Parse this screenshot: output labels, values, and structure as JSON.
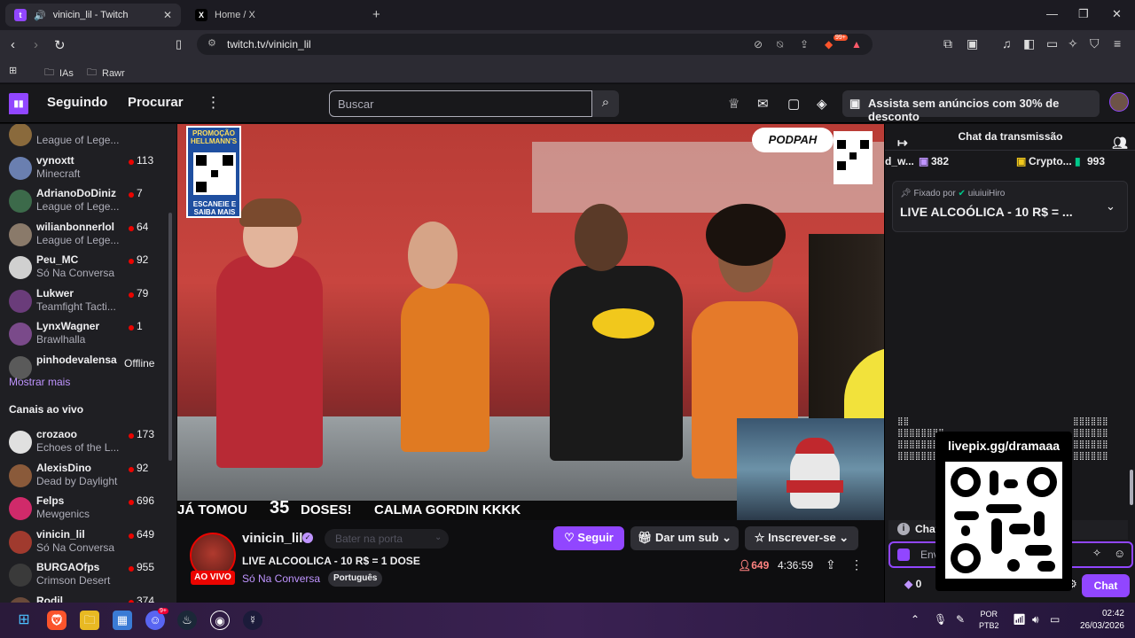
{
  "browser": {
    "tabs": [
      {
        "title": "vinicin_lil - Twitch"
      },
      {
        "title": "Home / X"
      }
    ],
    "url": "twitch.tv/vinicin_lil",
    "bookmarks": [
      "IAs",
      "Rawr"
    ],
    "brave_badge": "99+"
  },
  "twitch_nav": {
    "following": "Seguindo",
    "browse": "Procurar",
    "search_placeholder": "Buscar",
    "promo": "Assista sem anúncios com 30% de desconto"
  },
  "sidebar": {
    "followed": [
      {
        "name": "",
        "game": "League of Lege...",
        "viewers": "",
        "color": "#8a6a3c"
      },
      {
        "name": "vynoxtt",
        "game": "Minecraft",
        "viewers": "113",
        "color": "#6a7fb0"
      },
      {
        "name": "AdrianoDoDiniz",
        "game": "League of Lege...",
        "viewers": "7",
        "color": "#3c6a4a"
      },
      {
        "name": "wilianbonnerlol",
        "game": "League of Lege...",
        "viewers": "64",
        "color": "#8a7a6a"
      },
      {
        "name": "Peu_MC",
        "game": "Só Na Conversa",
        "viewers": "92",
        "color": "#d0d0d0"
      },
      {
        "name": "Lukwer",
        "game": "Teamfight Tacti...",
        "viewers": "79",
        "color": "#6a3c7a"
      },
      {
        "name": "LynxWagner",
        "game": "Brawlhalla",
        "viewers": "1",
        "color": "#7a4a8a"
      },
      {
        "name": "pinhodevalensa",
        "game": "",
        "viewers": "",
        "offline": "Offline",
        "color": "#5a5a5a"
      }
    ],
    "show_more": "Mostrar mais",
    "live_header": "Canais ao vivo",
    "live": [
      {
        "name": "crozaoo",
        "game": "Echoes of the L...",
        "viewers": "173",
        "color": "#e0e0e0"
      },
      {
        "name": "AlexisDino",
        "game": "Dead by Daylight",
        "viewers": "92",
        "color": "#8a5a3a"
      },
      {
        "name": "Felps",
        "game": "Mewgenics",
        "viewers": "696",
        "color": "#d02a6a"
      },
      {
        "name": "vinicin_lil",
        "game": "Só Na Conversa",
        "viewers": "649",
        "color": "#a03a2e"
      },
      {
        "name": "BURGAOfps",
        "game": "Crimson Desert",
        "viewers": "955",
        "color": "#3a3a3a"
      },
      {
        "name": "Rodil",
        "game": "",
        "viewers": "374",
        "color": "#6a4a3a"
      }
    ]
  },
  "video": {
    "hellmanns": "PROMOÇÃO HELLMANN'S",
    "hellmanns_cta": "ESCANEIE E SAIBA MAIS",
    "podpah": "PODPAH",
    "ticker": [
      "JÁ TOMOU",
      "35",
      "DOSES!",
      "CALMA GORDIN KKKK"
    ]
  },
  "stream": {
    "streamer": "vinicin_lil",
    "knock": "Bater na porta",
    "title": "LIVE ALCOOLICA - 10 R$ = 1 DOSE",
    "category": "Só Na Conversa",
    "tag": "Português",
    "live_badge": "AO VIVO",
    "follow": "Seguir",
    "gift": "Dar um sub",
    "subscribe": "Inscrever-se",
    "viewers": "649",
    "uptime": "4:36:59"
  },
  "chat": {
    "header": "Chat da transmissão",
    "gifts": [
      {
        "name": "d_w...",
        "count": "382"
      },
      {
        "name": "Crypto...",
        "count": "993"
      }
    ],
    "pinned_by_label": "Fixado por",
    "pinned_by_user": "uiuiuiHiro",
    "pinned_message": "LIVE ALCOÓLICA - 10 R$ = ...",
    "rules_label": "Chat",
    "input_placeholder": "Env",
    "points": "0",
    "chat_button": "Chat",
    "overlay_url": "livepix.gg/dramaaa"
  },
  "taskbar": {
    "lang_top": "POR",
    "lang_bottom": "PTB2",
    "time": "02:42",
    "date": "26/03/2026",
    "discord_badge": "9+"
  }
}
